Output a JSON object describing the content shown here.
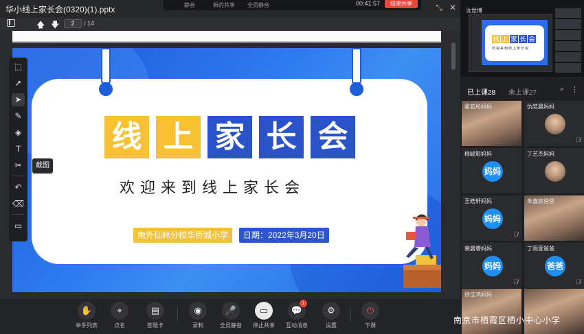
{
  "window": {
    "title": "华小线上家长会(0320)(1).pptx"
  },
  "share_bar": {
    "items": [
      "静音",
      "新的共享",
      "全员静音"
    ],
    "timer": "00:41:57",
    "end_label": "结束共享"
  },
  "navbar": {
    "page_current": "2",
    "page_total": "/ 14"
  },
  "slide": {
    "title_chars": [
      "线",
      "上",
      "家",
      "长",
      "会"
    ],
    "subtitle": "欢迎来到线上家长会",
    "school": "南外仙林分校华侨城小学",
    "date": "日期：2022年3月20日"
  },
  "annotation": {
    "tooltip": "截图"
  },
  "bottom_toolbar": {
    "items": [
      {
        "label": "举手列表",
        "icon": "raise-hand-icon"
      },
      {
        "label": "点名",
        "icon": "location-pin-icon"
      },
      {
        "label": "答题卡",
        "icon": "answer-card-icon"
      },
      {
        "label": "录制",
        "icon": "record-icon"
      },
      {
        "label": "全员静音",
        "icon": "mute-all-icon"
      },
      {
        "label": "停止共享",
        "icon": "stop-share-icon"
      },
      {
        "label": "互动消息",
        "icon": "chat-icon"
      },
      {
        "label": "设置",
        "icon": "gear-icon"
      },
      {
        "label": "下课",
        "icon": "power-icon"
      }
    ],
    "chat_badge": "1"
  },
  "right_panel": {
    "thumb_label": "沈世博",
    "mini_title_chars": [
      "线",
      "上",
      "家",
      "长",
      "会"
    ],
    "mini_subtitle": "欢迎来到线上家长会",
    "tabs": {
      "joined": "已上课28",
      "not_joined": "未上课27"
    },
    "participants": [
      {
        "name": "霍若彤妈妈",
        "type": "photo"
      },
      {
        "name": "仇皓晨妈妈",
        "type": "avatar-photo"
      },
      {
        "name": "梅峻彰妈妈",
        "type": "avatar",
        "avatar_text": "妈妈"
      },
      {
        "name": "丁艺杰妈妈",
        "type": "avatar-photo"
      },
      {
        "name": "王皓轩妈妈",
        "type": "avatar",
        "avatar_text": "妈妈"
      },
      {
        "name": "朱鑫宸爸爸",
        "type": "photo"
      },
      {
        "name": "裴晨睿妈妈",
        "type": "avatar",
        "avatar_text": "妈妈"
      },
      {
        "name": "丁雨萱爸爸",
        "type": "avatar",
        "avatar_text": "爸爸"
      },
      {
        "name": "徐佳鸿妈妈",
        "type": "photo"
      },
      {
        "name": "",
        "type": "photo"
      }
    ]
  },
  "watermark": "南京市栖霞区栖小中心小学"
}
